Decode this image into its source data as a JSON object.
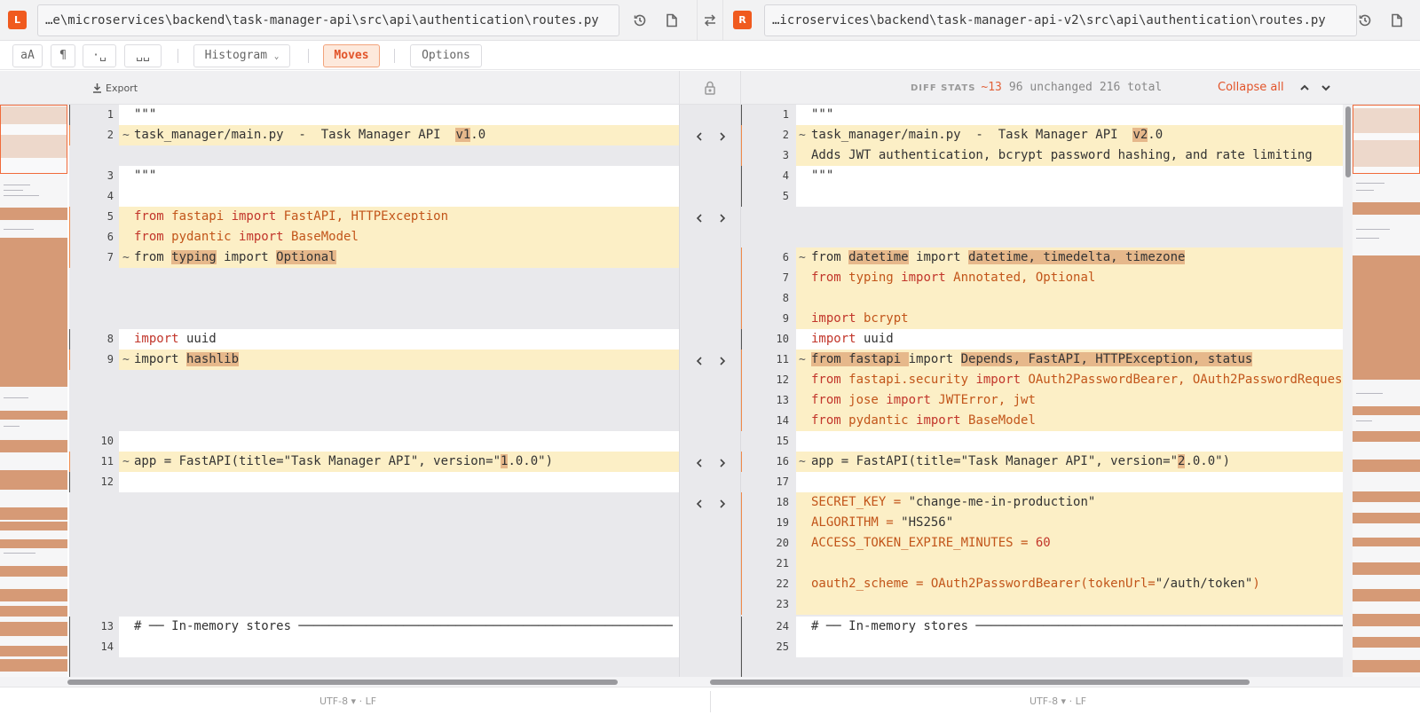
{
  "left": {
    "badge": "L",
    "path": "…e\\microservices\\backend\\task-manager-api\\src\\api\\authentication\\routes.py"
  },
  "right": {
    "badge": "R",
    "path": "…icroservices\\backend\\task-manager-api-v2\\src\\api\\authentication\\routes.py"
  },
  "toolbar": {
    "case_label": "aA",
    "pilcrow_label": "¶",
    "dot_label": "·␣",
    "space_label": "␣␣",
    "histogram_label": "Histogram",
    "moves_label": "Moves",
    "options_label": "Options"
  },
  "header": {
    "export_label": "Export",
    "diff_stats_label": "DIFF STATS",
    "changed": "~13",
    "unchanged": "96 unchanged",
    "total": "216 total",
    "collapse_all": "Collapse all"
  },
  "status": {
    "left": "UTF-8 ▾ · LF",
    "right": "UTF-8 ▾ · LF"
  },
  "colors": {
    "accent": "#f05a1e",
    "changed_bg": "#fcefc6",
    "changed_word_bg": "#e6b88b",
    "keyword": "#c2362b"
  }
}
